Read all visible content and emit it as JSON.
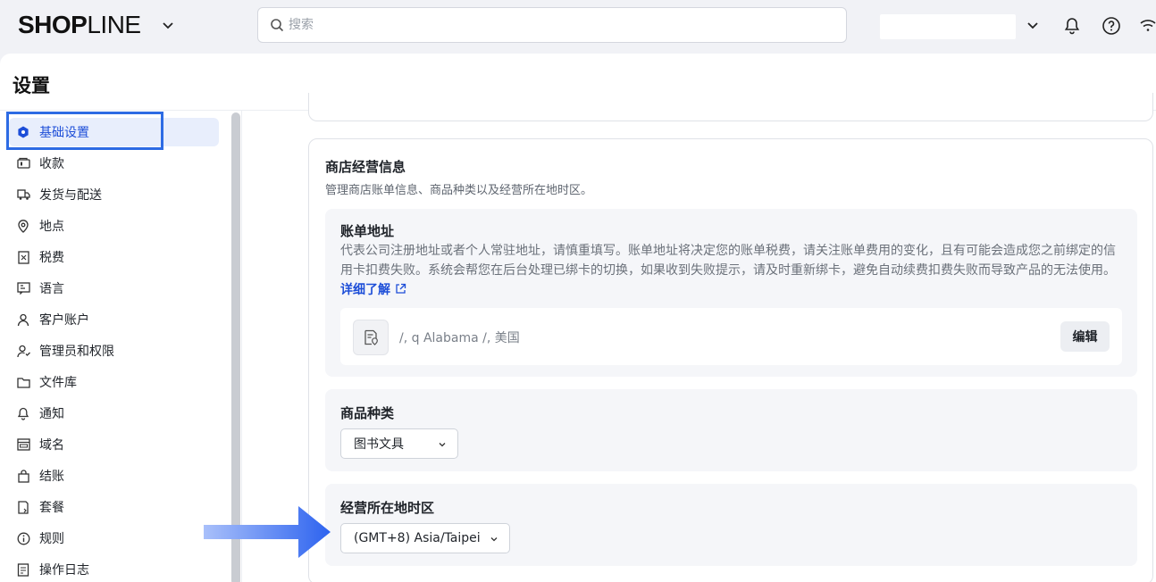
{
  "topbar": {
    "logo_bold": "SHOP",
    "logo_light": "LINE",
    "search_placeholder": "搜索"
  },
  "page": {
    "title": "设置"
  },
  "sidebar": {
    "items": [
      {
        "label": "基础设置",
        "icon": "settings-hex-icon",
        "active": true
      },
      {
        "label": "收款",
        "icon": "wallet-icon"
      },
      {
        "label": "发货与配送",
        "icon": "truck-icon"
      },
      {
        "label": "地点",
        "icon": "location-pin-icon"
      },
      {
        "label": "税费",
        "icon": "tax-receipt-icon"
      },
      {
        "label": "语言",
        "icon": "language-icon"
      },
      {
        "label": "客户账户",
        "icon": "user-icon"
      },
      {
        "label": "管理员和权限",
        "icon": "admin-user-icon"
      },
      {
        "label": "文件库",
        "icon": "folder-icon"
      },
      {
        "label": "通知",
        "icon": "bell-icon"
      },
      {
        "label": "域名",
        "icon": "domain-icon"
      },
      {
        "label": "结账",
        "icon": "shopping-bag-icon"
      },
      {
        "label": "套餐",
        "icon": "plan-icon"
      },
      {
        "label": "规则",
        "icon": "info-icon"
      },
      {
        "label": "操作日志",
        "icon": "log-icon"
      }
    ]
  },
  "business_info": {
    "title": "商店经营信息",
    "subtitle": "管理商店账单信息、商品种类以及经营所在地时区。",
    "billing": {
      "title": "账单地址",
      "description": "代表公司注册地址或者个人常驻地址，请慎重填写。账单地址将决定您的账单税费，请关注账单费用的变化，且有可能会造成您之前绑定的信用卡扣费失败。系统会帮您在后台处理已绑卡的切换，如果收到失败提示，请及时重新绑卡，避免自动续费扣费失败而导致产品的无法使用。",
      "learn_more": "详细了解",
      "address": "/, q Alabama /, 美国",
      "edit_label": "编辑"
    },
    "category": {
      "title": "商品种类",
      "value": "图书文具"
    },
    "timezone": {
      "title": "经营所在地时区",
      "value": "(GMT+8) Asia/Taipei"
    }
  },
  "colors": {
    "accent": "#1d4ed8",
    "highlight_border": "#2d6be4",
    "arrow": "#3b6cf0"
  }
}
